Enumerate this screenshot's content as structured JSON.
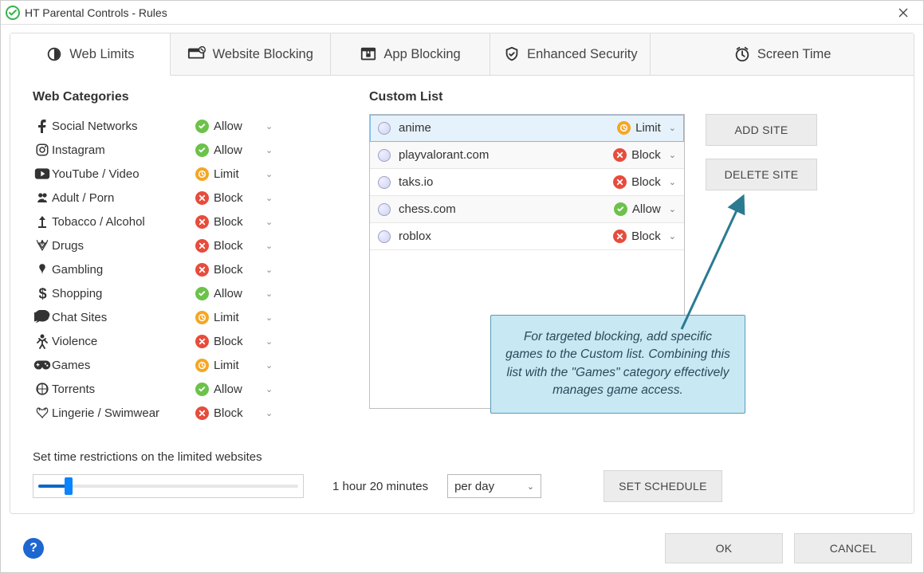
{
  "window": {
    "title": "HT Parental Controls - Rules"
  },
  "tabs": [
    {
      "label": "Web Limits"
    },
    {
      "label": "Website Blocking"
    },
    {
      "label": "App Blocking"
    },
    {
      "label": "Enhanced Security"
    },
    {
      "label": "Screen Time"
    }
  ],
  "sections": {
    "categories_heading": "Web Categories",
    "custom_heading": "Custom List",
    "time_caption": "Set time restrictions on the limited websites",
    "time_value": "1 hour 20 minutes",
    "per_option": "per day"
  },
  "status_labels": {
    "allow": "Allow",
    "limit": "Limit",
    "block": "Block"
  },
  "categories": [
    {
      "label": "Social Networks",
      "status": "allow"
    },
    {
      "label": "Instagram",
      "status": "allow"
    },
    {
      "label": "YouTube / Video",
      "status": "limit"
    },
    {
      "label": "Adult / Porn",
      "status": "block"
    },
    {
      "label": "Tobacco / Alcohol",
      "status": "block"
    },
    {
      "label": "Drugs",
      "status": "block"
    },
    {
      "label": "Gambling",
      "status": "block"
    },
    {
      "label": "Shopping",
      "status": "allow"
    },
    {
      "label": "Chat Sites",
      "status": "limit"
    },
    {
      "label": "Violence",
      "status": "block"
    },
    {
      "label": "Games",
      "status": "limit"
    },
    {
      "label": "Torrents",
      "status": "allow"
    },
    {
      "label": "Lingerie / Swimwear",
      "status": "block"
    }
  ],
  "custom_list": [
    {
      "label": "anime",
      "status": "limit",
      "selected": true
    },
    {
      "label": "playvalorant.com",
      "status": "block",
      "selected": false
    },
    {
      "label": "taks.io",
      "status": "block",
      "selected": false
    },
    {
      "label": "chess.com",
      "status": "allow",
      "selected": false
    },
    {
      "label": "roblox",
      "status": "block",
      "selected": false
    }
  ],
  "buttons": {
    "add_site": "ADD SITE",
    "delete_site": "DELETE SITE",
    "set_schedule": "SET SCHEDULE",
    "ok": "OK",
    "cancel": "CANCEL"
  },
  "callout": {
    "text": "For targeted blocking, add specific games to the Custom list. Combining this list with the \"Games\" category effectively manages game access."
  }
}
